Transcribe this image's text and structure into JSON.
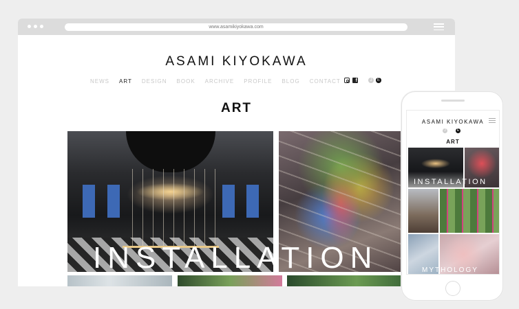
{
  "browser": {
    "url": "www.asamikiyokawa.com"
  },
  "site": {
    "title": "ASAMI KIYOKAWA",
    "nav": [
      "NEWS",
      "ART",
      "DESIGN",
      "BOOK",
      "ARCHIVE",
      "PROFILE",
      "BLOG",
      "CONTACT"
    ],
    "active_nav": "ART",
    "social_icons": [
      "instagram-icon",
      "facebook-icon"
    ],
    "lang": {
      "jp": "J",
      "en": "E",
      "selected": "E"
    },
    "section_title": "ART",
    "caption_main": "INSTALLATION"
  },
  "mobile": {
    "title": "ASAMI KIYOKAWA",
    "lang": {
      "jp": "J",
      "en": "E"
    },
    "section_title": "ART",
    "captions": [
      "INSTALLATION",
      "MYTHOLOGY"
    ]
  },
  "colors": {
    "background": "#eeeeee",
    "browser_bar": "#dcdcdc",
    "text": "#111111",
    "nav_inactive": "#c8c8c8"
  }
}
